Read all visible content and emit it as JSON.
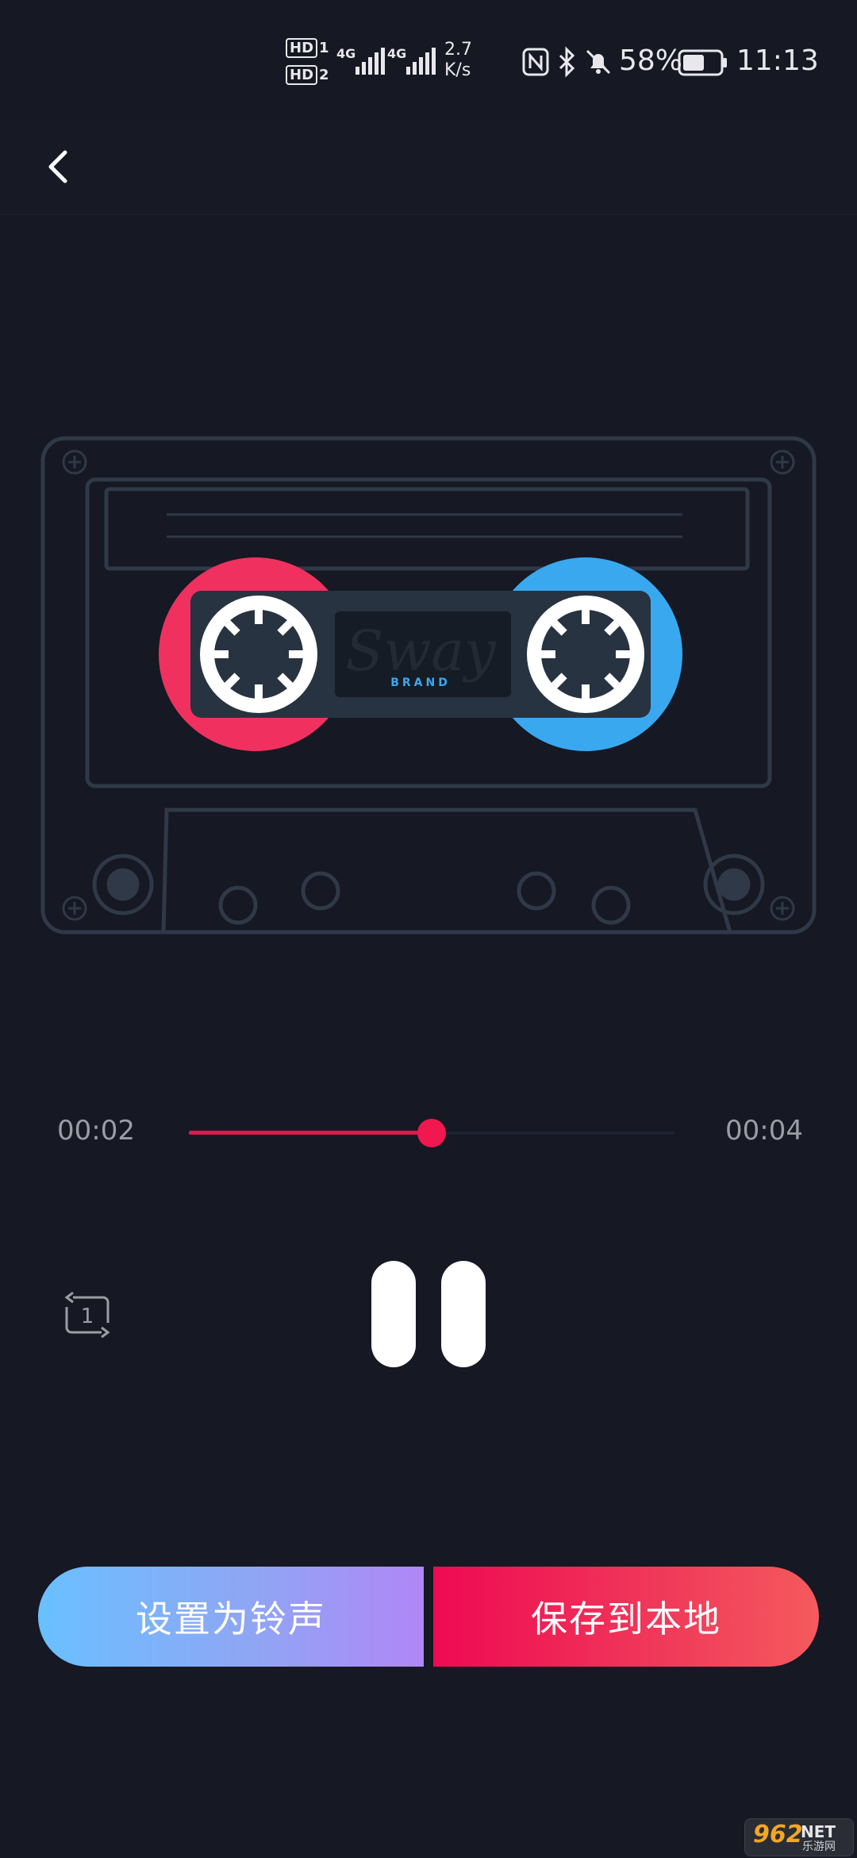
{
  "status_bar": {
    "hd1": "HD",
    "hd1_num": "1",
    "hd2": "HD",
    "hd2_num": "2",
    "net1": "4G",
    "net2": "4G",
    "speed_value": "2.7",
    "speed_unit": "K/s",
    "battery_percent": "58%",
    "battery_level": 0.58,
    "time": "11:13"
  },
  "player": {
    "current_time": "00:02",
    "total_time": "00:04",
    "progress": 0.5,
    "cassette_brand": "Sway",
    "cassette_sub": "BRAND",
    "accent_left": "#f0315f",
    "accent_right": "#3aa8ef",
    "repeat_label": "1"
  },
  "actions": {
    "set_ringtone": "设置为铃声",
    "save_local": "保存到本地"
  },
  "watermark": {
    "num": "962",
    "net": "NET",
    "sub": "乐游网"
  }
}
